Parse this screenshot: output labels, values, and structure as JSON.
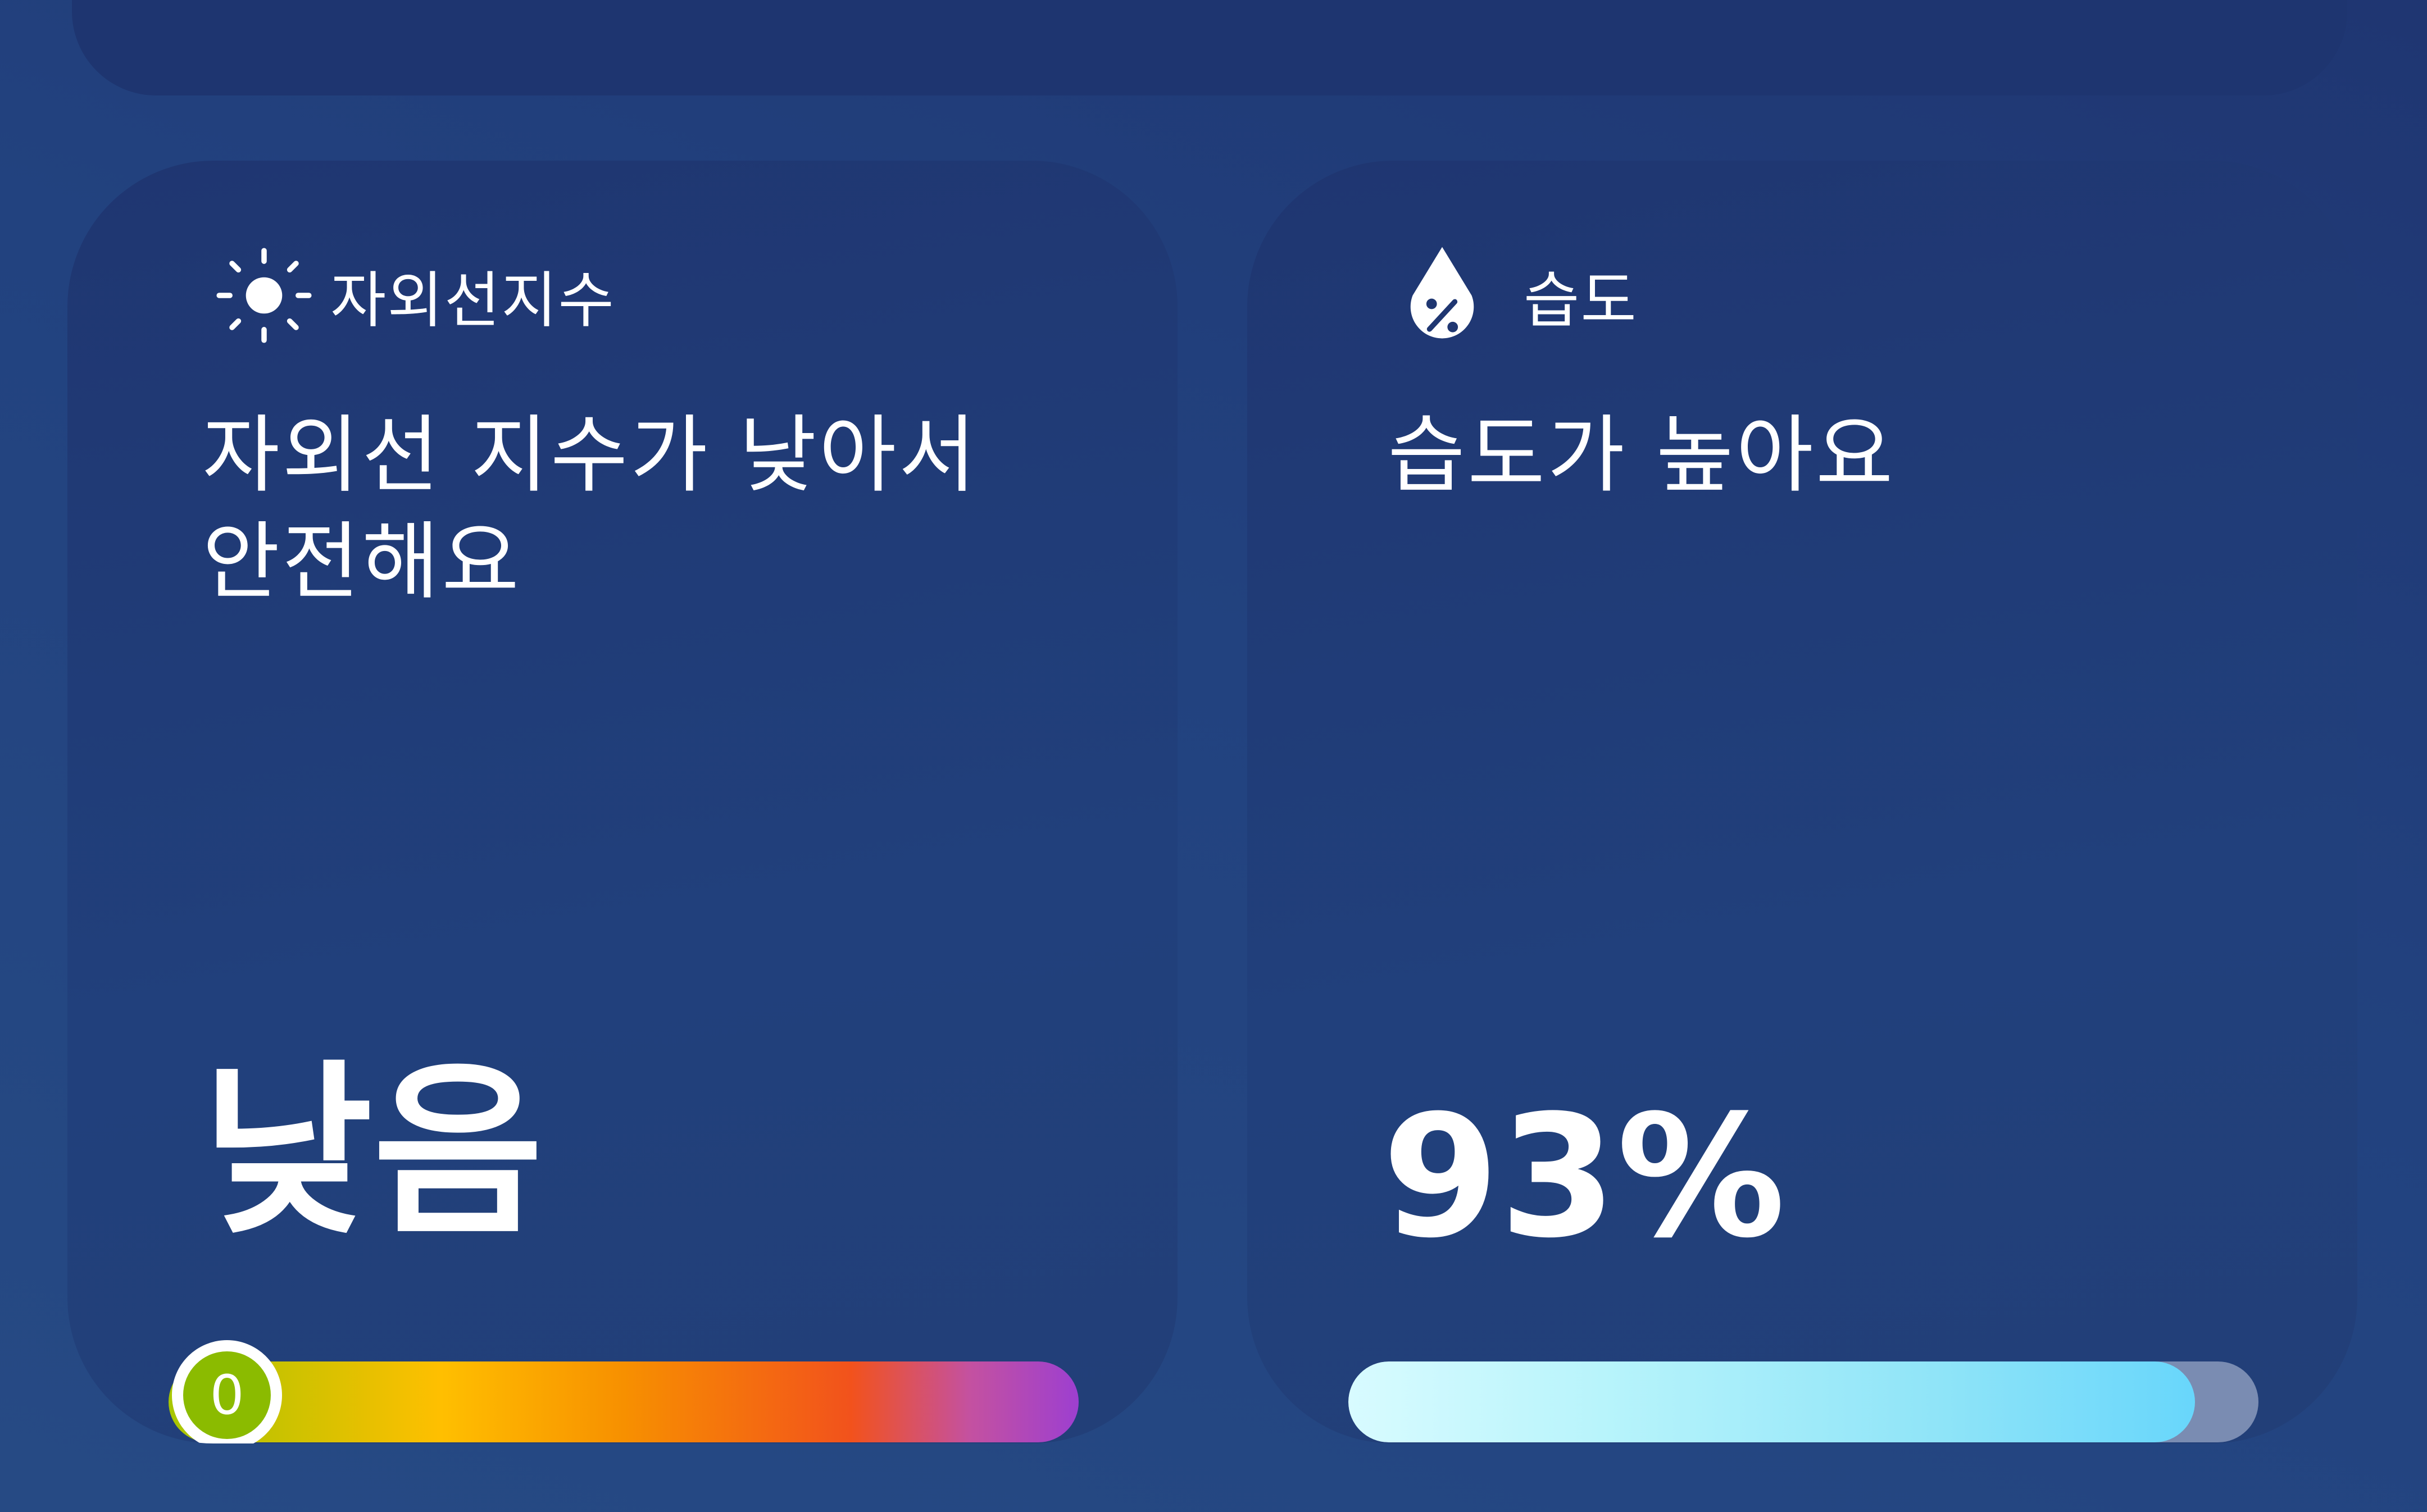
{
  "uv_card": {
    "label": "자외선지수",
    "icon": "sun-icon",
    "description": "자외선 지수가 낮아서 안전해요",
    "level_text": "낮음",
    "index_value": "0",
    "scale_position": 0.0,
    "gradient_colors": [
      "#a7c600",
      "#ffbf00",
      "#f79000",
      "#f2521c",
      "#9d3fd0"
    ]
  },
  "humidity_card": {
    "label": "습도",
    "icon": "humidity-drop-icon",
    "description": "습도가 높아요",
    "value_text": "93%",
    "value_fraction": 0.93,
    "bar_color": "#68d6fb",
    "track_color": "#7a8cb2"
  },
  "colors": {
    "background": "#22427f",
    "card": "#21407c"
  }
}
